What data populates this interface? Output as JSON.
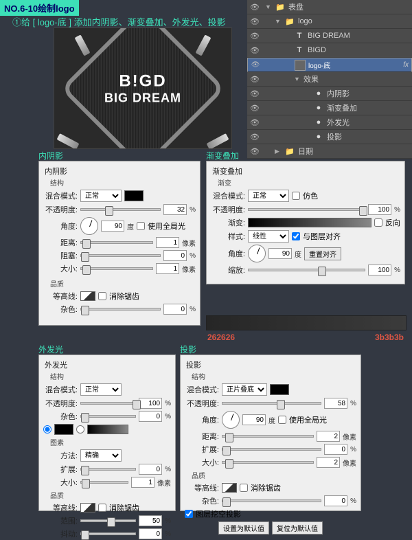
{
  "header": {
    "tag": "NO.6-10绘制logo",
    "anno": "①给 [ logo-底 ] 添加内阴影、渐变叠加、外发光、投影"
  },
  "preview": {
    "l1": "B!GD",
    "l2": "BIG DREAM"
  },
  "layers": {
    "items": [
      {
        "label": "表盘",
        "icon": "folder",
        "indent": 0,
        "fold": "▼"
      },
      {
        "label": "logo",
        "icon": "folder",
        "indent": 1,
        "fold": "▼"
      },
      {
        "label": "BIG DREAM",
        "icon": "T",
        "indent": 2
      },
      {
        "label": "BIGD",
        "icon": "T",
        "indent": 2
      },
      {
        "label": "logo-底",
        "icon": "thumb",
        "indent": 2,
        "sel": true,
        "fx": "fx"
      },
      {
        "label": "效果",
        "icon": "eye",
        "indent": 3,
        "fold": "▼"
      },
      {
        "label": "内阴影",
        "icon": "dot",
        "indent": 4
      },
      {
        "label": "渐变叠加",
        "icon": "dot",
        "indent": 4
      },
      {
        "label": "外发光",
        "icon": "dot",
        "indent": 4
      },
      {
        "label": "投影",
        "icon": "dot",
        "indent": 4
      },
      {
        "label": "日期",
        "icon": "folder",
        "indent": 1,
        "fold": "▶"
      }
    ]
  },
  "titles": {
    "inner": "内阴影",
    "grad": "渐变叠加",
    "glow": "外发光",
    "shadow": "投影"
  },
  "labels": {
    "struct": "结构",
    "blend": "混合模式:",
    "opacity": "不透明度:",
    "angle": "角度:",
    "global": "使用全局光",
    "dist": "距离:",
    "choke": "阻塞:",
    "spread": "扩展:",
    "size": "大小:",
    "quality": "品质",
    "contour": "等高线:",
    "anti": "消除锯齿",
    "noise": "杂色:",
    "gradient": "渐变:",
    "reverse": "反向",
    "style": "样式:",
    "align": "与图层对齐",
    "scale": "缩放:",
    "dither": "仿色",
    "reset": "重置对齐",
    "method": "方法:",
    "range": "范围:",
    "jitter": "抖动:",
    "deg": "度",
    "px": "像素",
    "pct": "%",
    "knockout": "图层挖空投影",
    "default": "设置为默认值",
    "resetdef": "复位为默认值"
  },
  "inner": {
    "blend": "正常",
    "opacity": "32",
    "angle": "90",
    "dist": "1",
    "choke": "0",
    "size": "1",
    "noise": "0"
  },
  "gradov": {
    "blend": "正常",
    "opacity": "100",
    "style": "线性",
    "angle": "90",
    "scale": "100"
  },
  "glow": {
    "blend": "正常",
    "opacity": "100",
    "noise": "0",
    "method": "精确",
    "spread": "0",
    "size": "1",
    "range": "50",
    "jitter": "0"
  },
  "shadow": {
    "blend": "正片叠底",
    "opacity": "58",
    "angle": "90",
    "dist": "2",
    "spread": "0",
    "size": "2",
    "noise": "0"
  },
  "gradstops": {
    "left": "262626",
    "right": "3b3b3b"
  }
}
